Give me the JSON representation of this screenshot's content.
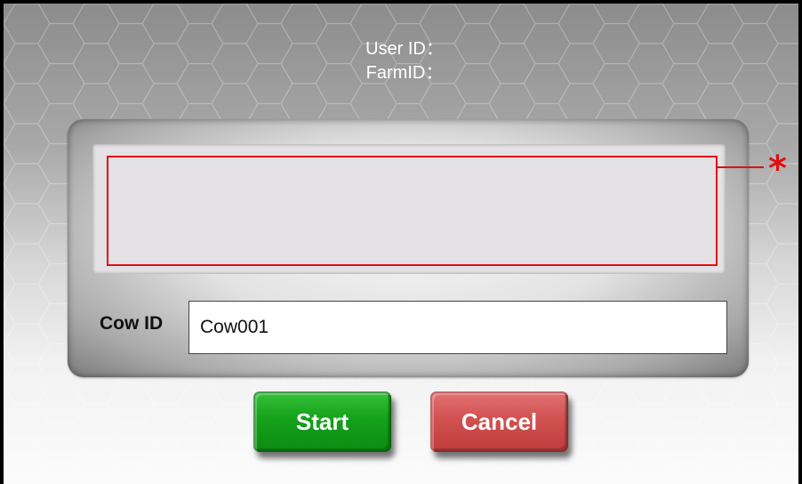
{
  "header": {
    "user_id_label": "User ID：",
    "farm_id_label": "FarmID："
  },
  "form": {
    "required_marker": "*",
    "cow_id_label": "Cow ID",
    "cow_id_value": "Cow001"
  },
  "buttons": {
    "start_label": "Start",
    "cancel_label": "Cancel"
  },
  "colors": {
    "start_button": "#14a21a",
    "cancel_button": "#d25151",
    "required_highlight": "#e01010"
  }
}
